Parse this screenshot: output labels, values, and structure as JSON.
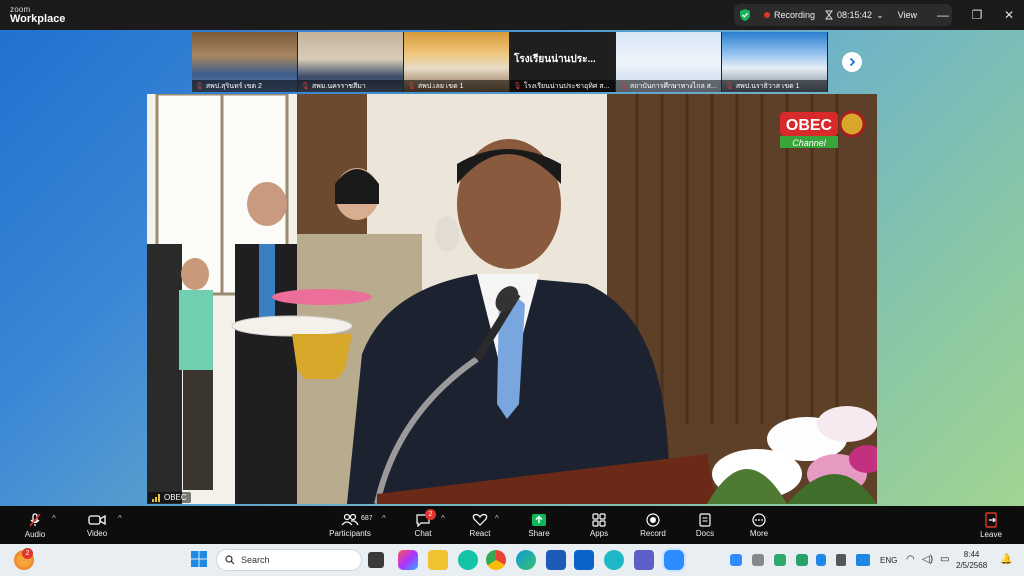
{
  "app": {
    "brand_top": "zoom",
    "brand_bottom": "Workplace"
  },
  "titlebar": {
    "recording_label": "Recording",
    "timer": "08:15:42",
    "view_label": "View"
  },
  "thumbnails": [
    {
      "label": "สพป.สุรินทร์ เขต 2"
    },
    {
      "label": "สพม.นครราชสีมา"
    },
    {
      "label": "สพป.เลย เขต 1"
    },
    {
      "label": "โรงเรียนน่านประชาอุทิศ ส...",
      "title": "โรงเรียนน่านประ..."
    },
    {
      "label": "สถาบันการศึกษาทางไกล ส..."
    },
    {
      "label": "สพป.นราธิวาส เขต 1"
    }
  ],
  "video": {
    "watermark": "OBEC",
    "watermark_sub": "Channel",
    "source_tag": "OBEC"
  },
  "toolbar": {
    "audio": "Audio",
    "video": "Video",
    "participants": "Participants",
    "participants_count": "687",
    "chat": "Chat",
    "chat_badge": "2",
    "react": "React",
    "share": "Share",
    "apps": "Apps",
    "record": "Record",
    "docs": "Docs",
    "more": "More",
    "leave": "Leave"
  },
  "taskbar": {
    "search_placeholder": "Search",
    "lang": "ENG",
    "time": "8:44",
    "date": "2/5/2568",
    "notif_badge": "2"
  },
  "colors": {
    "accent_red": "#e0352b",
    "toolbar_bg": "#0d0d0d",
    "titlebar_bg": "#1b1b1b",
    "share_green": "#0db85a"
  }
}
